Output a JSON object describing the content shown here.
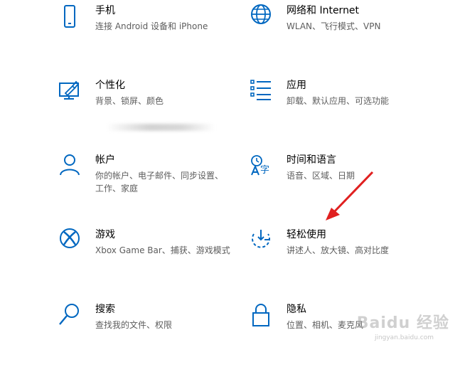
{
  "accent_color": "#0067c0",
  "tiles": [
    {
      "title": "手机",
      "desc": "连接 Android 设备和 iPhone",
      "icon": "phone-icon"
    },
    {
      "title": "网络和 Internet",
      "desc": "WLAN、飞行模式、VPN",
      "icon": "globe-icon"
    },
    {
      "title": "个性化",
      "desc": "背景、锁屏、颜色",
      "icon": "personalization-icon"
    },
    {
      "title": "应用",
      "desc": "卸载、默认应用、可选功能",
      "icon": "apps-list-icon"
    },
    {
      "title": "帐户",
      "desc": "你的帐户、电子邮件、同步设置、工作、家庭",
      "icon": "account-icon"
    },
    {
      "title": "时间和语言",
      "desc": "语音、区域、日期",
      "icon": "time-language-icon"
    },
    {
      "title": "游戏",
      "desc": "Xbox Game Bar、捕获、游戏模式",
      "icon": "xbox-icon"
    },
    {
      "title": "轻松使用",
      "desc": "讲述人、放大镜、高对比度",
      "icon": "ease-of-access-icon"
    },
    {
      "title": "搜索",
      "desc": "查找我的文件、权限",
      "icon": "search-icon"
    },
    {
      "title": "隐私",
      "desc": "位置、相机、麦克风",
      "icon": "lock-icon"
    }
  ],
  "watermark": {
    "text": "Baidu 经验",
    "url": "jingyan.baidu.com"
  }
}
